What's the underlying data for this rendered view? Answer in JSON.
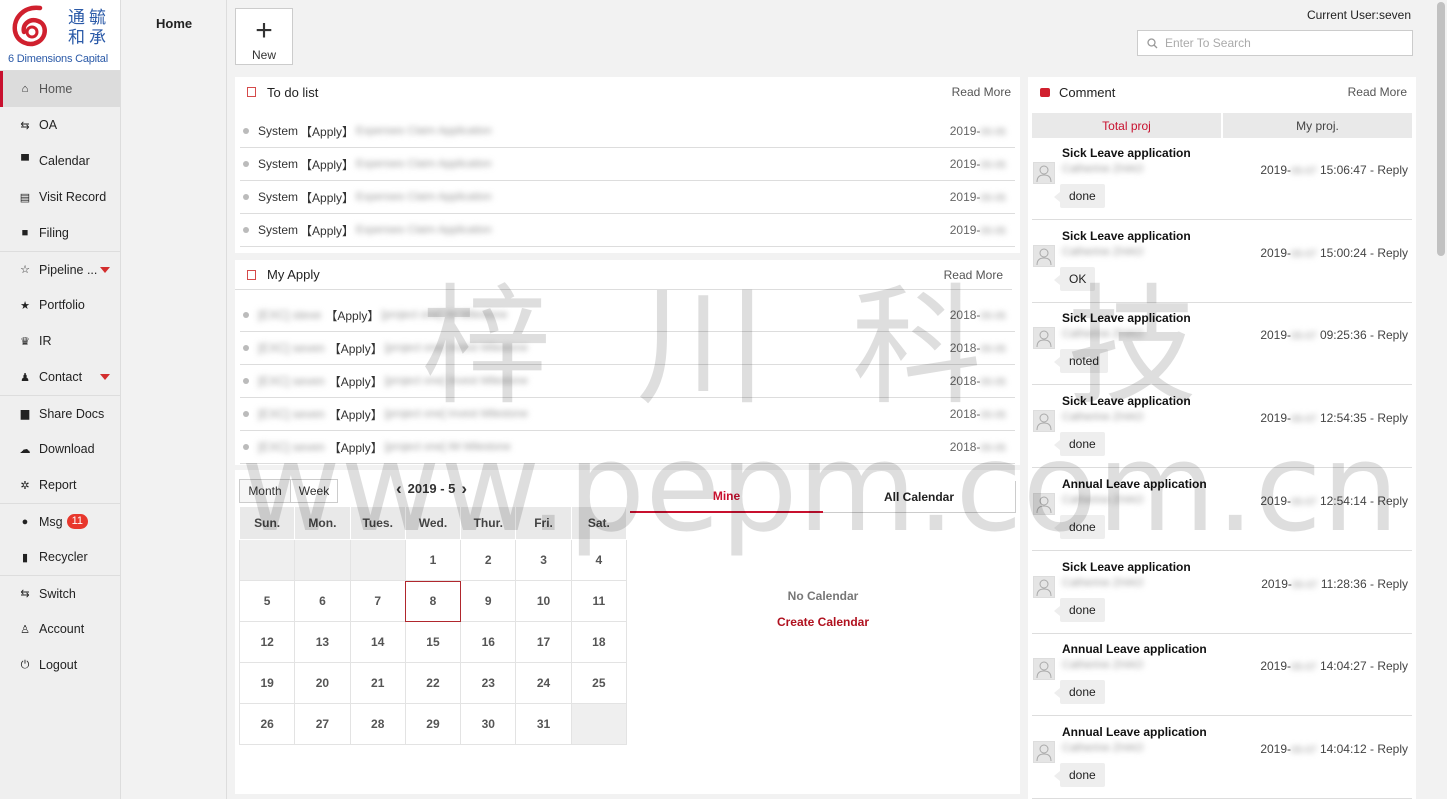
{
  "logo": {
    "cn": "通毓和承",
    "en": "6 Dimensions Capital"
  },
  "sidebar": {
    "items": [
      {
        "label": "Home",
        "icon": "home-icon",
        "glyph": "⌂"
      },
      {
        "label": "OA",
        "icon": "swap-icon",
        "glyph": "⇆"
      },
      {
        "label": "Calendar",
        "icon": "calendar-icon",
        "glyph": "▀"
      },
      {
        "label": "Visit Record",
        "icon": "document-icon",
        "glyph": "▤"
      },
      {
        "label": "Filing",
        "icon": "briefcase-icon",
        "glyph": "■"
      },
      {
        "label": "Pipeline ...",
        "icon": "star-outline-icon",
        "glyph": "☆"
      },
      {
        "label": "Portfolio",
        "icon": "star-icon",
        "glyph": "★"
      },
      {
        "label": "IR",
        "icon": "trophy-icon",
        "glyph": "♛"
      },
      {
        "label": "Contact",
        "icon": "users-icon",
        "glyph": "♟"
      },
      {
        "label": "Share Docs",
        "icon": "folder-icon",
        "glyph": "▆"
      },
      {
        "label": "Download",
        "icon": "cloud-download-icon",
        "glyph": "☁"
      },
      {
        "label": "Report",
        "icon": "gear-icon",
        "glyph": "✲"
      },
      {
        "label": "Msg",
        "icon": "chat-icon",
        "glyph": "●",
        "badge": "11"
      },
      {
        "label": "Recycler",
        "icon": "trash-icon",
        "glyph": "▮"
      },
      {
        "label": "Switch",
        "icon": "swap-icon",
        "glyph": "⇆"
      },
      {
        "label": "Account",
        "icon": "user-icon",
        "glyph": "♙"
      },
      {
        "label": "Logout",
        "icon": "power-icon",
        "glyph": "⏻"
      }
    ]
  },
  "column2": {
    "title": "Home"
  },
  "header": {
    "new_label": "New",
    "new_glyph": "+",
    "current_user": "Current User:seven",
    "search_placeholder": "Enter To Search"
  },
  "todo": {
    "title": "To do list",
    "more": "Read More",
    "rows": [
      {
        "source": "System",
        "tag": "【Apply】",
        "subject": "Expenses Claim Application",
        "date": "2019-"
      },
      {
        "source": "System",
        "tag": "【Apply】",
        "subject": "Expenses Claim Application",
        "date": "2019-"
      },
      {
        "source": "System",
        "tag": "【Apply】",
        "subject": "Expenses Claim Application",
        "date": "2019-"
      },
      {
        "source": "System",
        "tag": "【Apply】",
        "subject": "Expenses Claim Application",
        "date": "2019-"
      }
    ]
  },
  "myapply": {
    "title": "My Apply",
    "more": "Read More",
    "rows": [
      {
        "source": "[EXC] steve",
        "tag": "【Apply】",
        "subject": "[project one] IM Milestone",
        "date": "2018-"
      },
      {
        "source": "[EXC] seven",
        "tag": "【Apply】",
        "subject": "[project one] Invest Milestone",
        "date": "2018-"
      },
      {
        "source": "[EXC] seven",
        "tag": "【Apply】",
        "subject": "[project one] Invest Milestone",
        "date": "2018-"
      },
      {
        "source": "[EXC] seven",
        "tag": "【Apply】",
        "subject": "[project one] Invest Milestone",
        "date": "2018-"
      },
      {
        "source": "[EXC] seven",
        "tag": "【Apply】",
        "subject": "[project one] IM Milestone",
        "date": "2018-"
      }
    ]
  },
  "calendar": {
    "view_month": "Month",
    "view_week": "Week",
    "prev": "‹",
    "next": "›",
    "period": "2019 - 5",
    "weekdays": [
      "Sun.",
      "Mon.",
      "Tues.",
      "Wed.",
      "Thur.",
      "Fri.",
      "Sat."
    ],
    "weeks": [
      [
        "",
        "",
        "",
        "1",
        "2",
        "3",
        "4"
      ],
      [
        "5",
        "6",
        "7",
        "8",
        "9",
        "10",
        "11"
      ],
      [
        "12",
        "13",
        "14",
        "15",
        "16",
        "17",
        "18"
      ],
      [
        "19",
        "20",
        "21",
        "22",
        "23",
        "24",
        "25"
      ],
      [
        "26",
        "27",
        "28",
        "29",
        "30",
        "31",
        ""
      ]
    ],
    "today": "8",
    "tab_mine": "Mine",
    "tab_all": "All Calendar",
    "empty": "No Calendar",
    "create": "Create Calendar"
  },
  "comment": {
    "title": "Comment",
    "more": "Read More",
    "tab_total": "Total proj",
    "tab_my": "My proj.",
    "items": [
      {
        "title": "Sick Leave application",
        "who": "Catherine ZHAO",
        "date": "2019-",
        "time": "15:06:47",
        "reply": " - Reply",
        "text": "done"
      },
      {
        "title": "Sick Leave application",
        "who": "Catherine ZHAO",
        "date": "2019-",
        "time": "15:00:24",
        "reply": " - Reply",
        "text": "OK"
      },
      {
        "title": "Sick Leave application",
        "who": "Catherine ZHAO",
        "date": "2019-",
        "time": "09:25:36",
        "reply": " - Reply",
        "text": "noted"
      },
      {
        "title": "Sick Leave application",
        "who": "Catherine ZHAO",
        "date": "2019-",
        "time": "12:54:35",
        "reply": " - Reply",
        "text": "done"
      },
      {
        "title": "Annual Leave application",
        "who": "Catherine ZHAO",
        "date": "2019-",
        "time": "12:54:14",
        "reply": " - Reply",
        "text": "done"
      },
      {
        "title": "Sick Leave application",
        "who": "Catherine ZHAO",
        "date": "2019-",
        "time": "11:28:36",
        "reply": " - Reply",
        "text": "done"
      },
      {
        "title": "Annual Leave application",
        "who": "Catherine ZHAO",
        "date": "2019-",
        "time": "14:04:27",
        "reply": " - Reply",
        "text": "done"
      },
      {
        "title": "Annual Leave application",
        "who": "Catherine ZHAO",
        "date": "2019-",
        "time": "14:04:12",
        "reply": " - Reply",
        "text": "done"
      }
    ]
  },
  "watermark": {
    "line1": "梓 川 科 技",
    "line2": "www.pepm.com.cn"
  },
  "colors": {
    "accent": "#c8102e",
    "badge": "#e8372c",
    "brand_blue": "#2b5aa8"
  }
}
